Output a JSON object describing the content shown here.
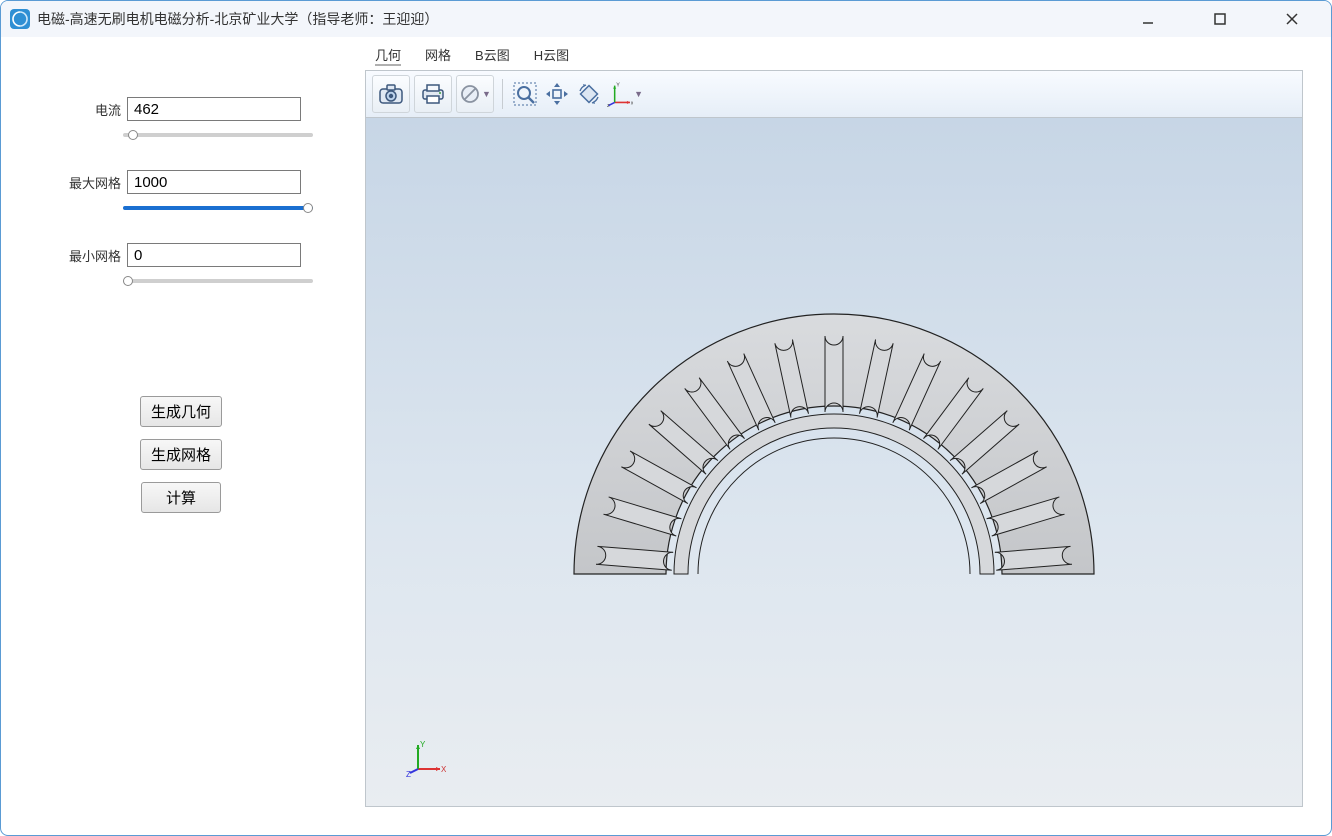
{
  "window": {
    "title": "电磁-高速无刷电机电磁分析-北京矿业大学（指导老师：王迎迎）"
  },
  "sidebar": {
    "current": {
      "label": "电流",
      "value": "462"
    },
    "max_mesh": {
      "label": "最大网格",
      "value": "1000"
    },
    "min_mesh": {
      "label": "最小网格",
      "value": "0"
    },
    "buttons": {
      "gen_geom": "生成几何",
      "gen_mesh": "生成网格",
      "compute": "计算"
    }
  },
  "tabs": {
    "geom": "几何",
    "mesh": "网格",
    "bcloud": "B云图",
    "hcloud": "H云图",
    "active": "geom"
  },
  "toolbar": {
    "camera": "camera-icon",
    "print": "printer-icon",
    "clip": "clip-plane-icon",
    "zoom": "zoom-box-icon",
    "pan": "pan-icon",
    "spin": "spin-icon",
    "axes": "axes-triad-icon"
  },
  "axes_labels": {
    "x": "x",
    "y": "Y",
    "z": "z"
  },
  "corner_axes_labels": {
    "x": "X",
    "y": "Y",
    "z": "Z"
  }
}
